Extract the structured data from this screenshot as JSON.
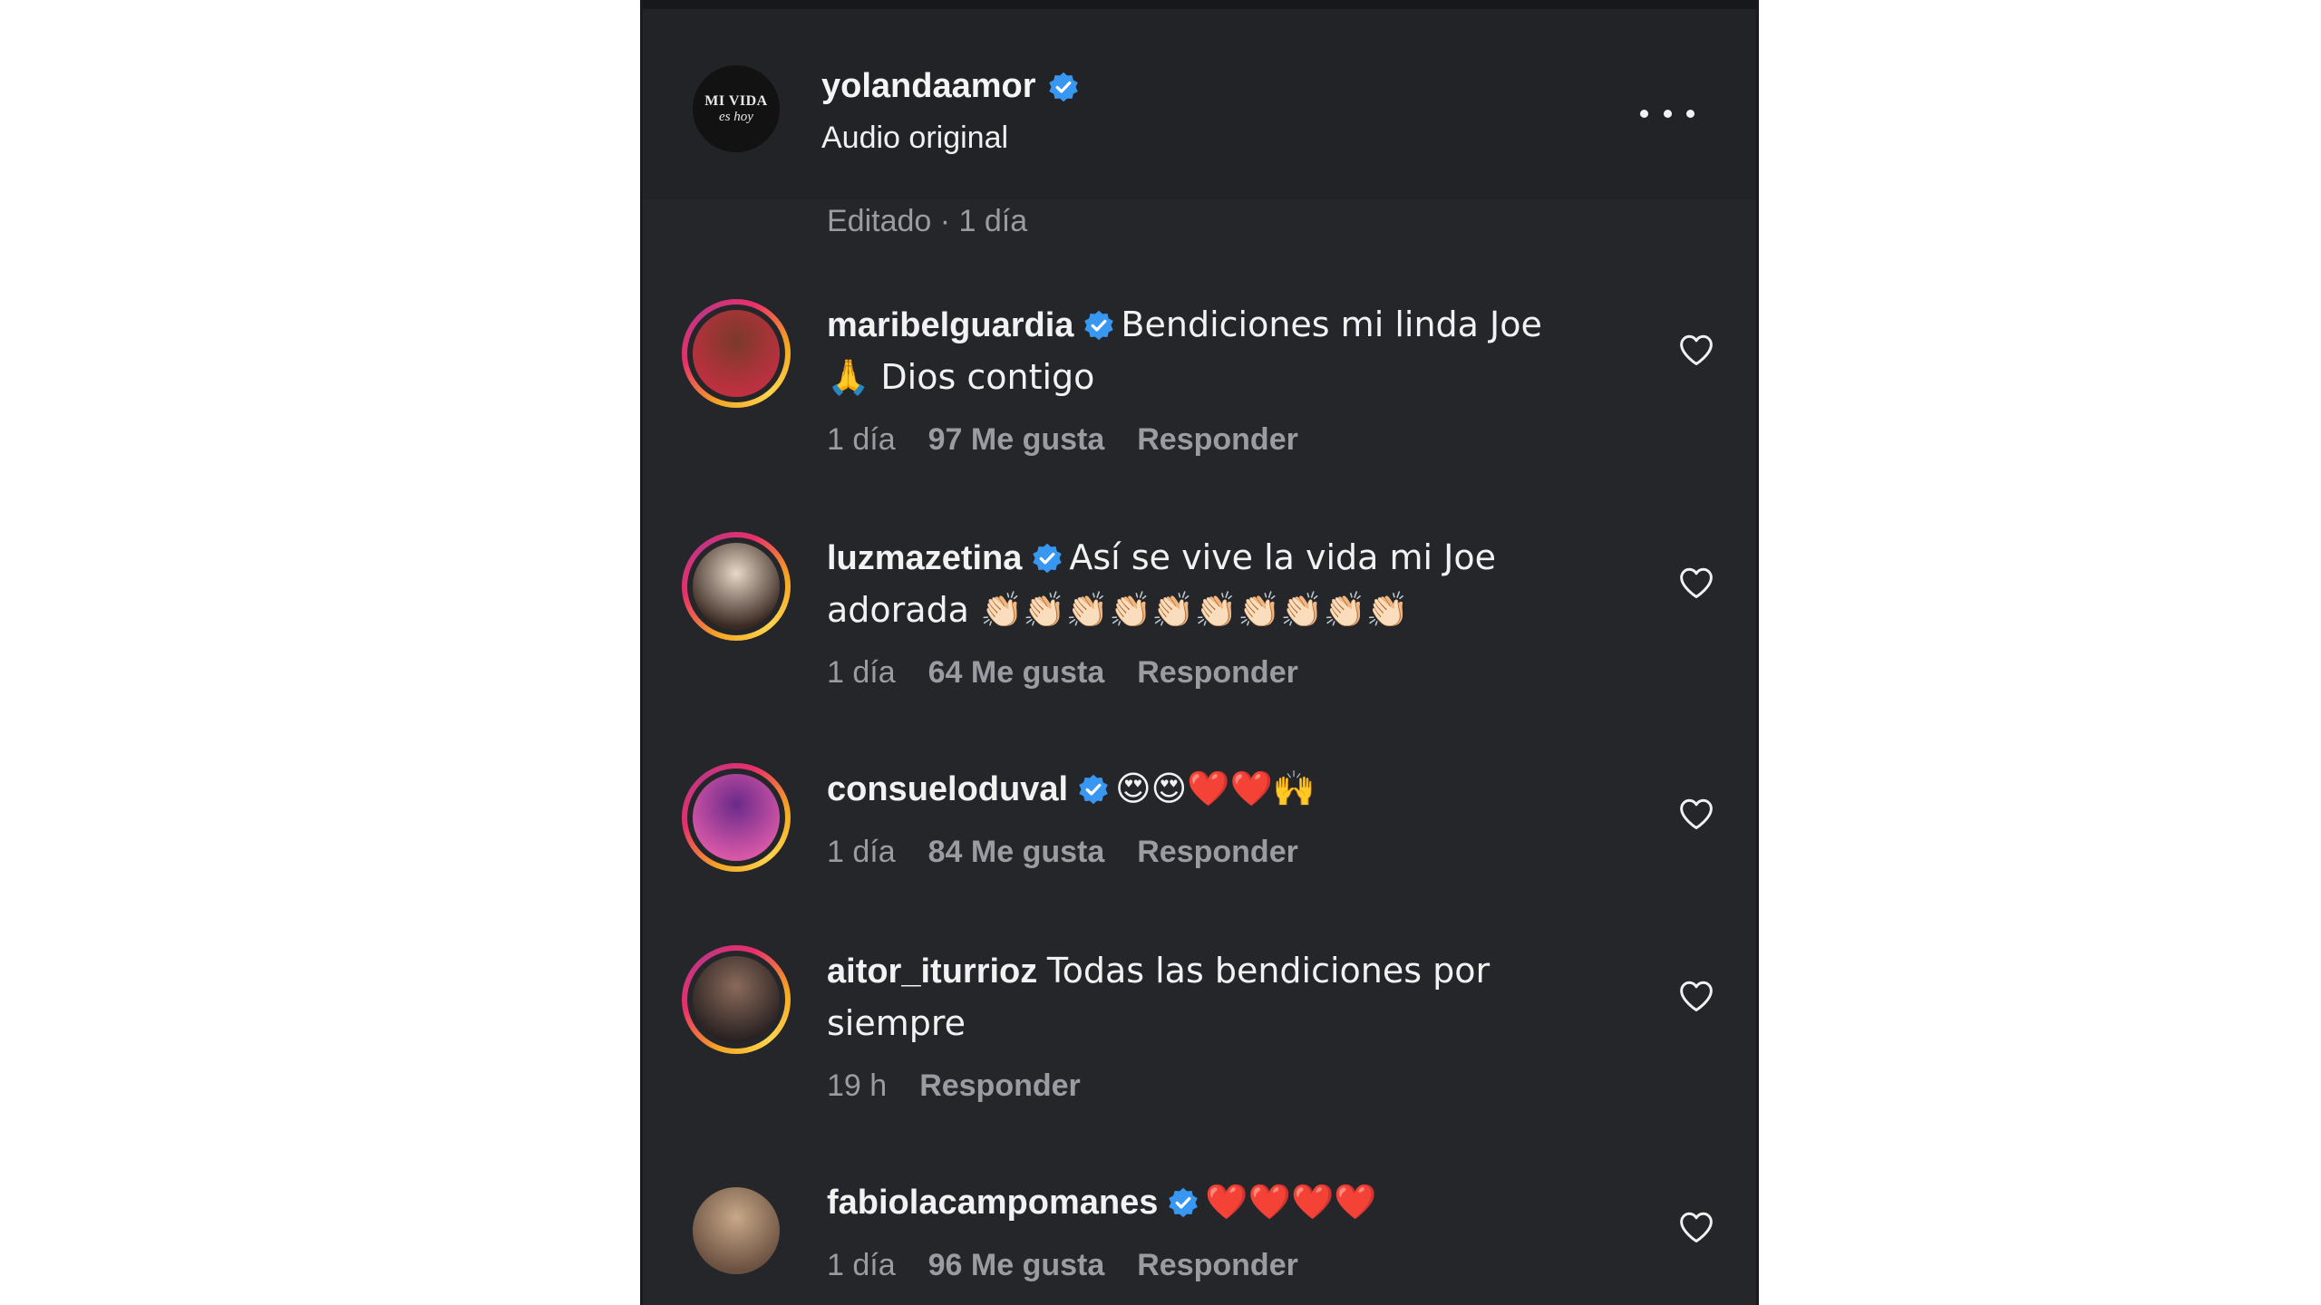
{
  "post": {
    "author": "yolandaamor",
    "audio_label": "Audio original",
    "edited_meta": "Editado · 1 día",
    "avatar_logo_top": "MI VIDA",
    "avatar_logo_bottom": "es hoy"
  },
  "colors": {
    "panel_bg": "#25262a",
    "header_bg": "#222326",
    "text_primary": "#f2f2f2",
    "text_secondary": "#9a9ca2",
    "verified_blue": "#3897f0",
    "heart_red": "#e0245e"
  },
  "comments": [
    {
      "username": "maribelguardia",
      "verified": true,
      "text_line1": "Bendiciones mi linda Joe",
      "text_line2": "🙏 Dios contigo",
      "time": "1 día",
      "likes": "97 Me gusta",
      "reply": "Responder",
      "avatar_colors": [
        "#7a3a2a",
        "#c03040"
      ]
    },
    {
      "username": "luzmazetina",
      "verified": true,
      "text_line1": "Así se vive la vida mi Joe",
      "text_line2": "adorada 👏🏻👏🏻👏🏻👏🏻👏🏻👏🏻👏🏻👏🏻👏🏻👏🏻",
      "time": "1 día",
      "likes": "64 Me gusta",
      "reply": "Responder",
      "avatar_colors": [
        "#e8d8c8",
        "#3a2a22"
      ]
    },
    {
      "username": "consueloduval",
      "verified": true,
      "text_line1": "😍😍❤️❤️🙌",
      "text_line2": "",
      "time": "1 día",
      "likes": "84 Me gusta",
      "reply": "Responder",
      "avatar_colors": [
        "#6a2a8a",
        "#d858a8"
      ]
    },
    {
      "username": "aitor_iturrioz",
      "verified": false,
      "text_line1": "Todas las bendiciones por",
      "text_line2": "siempre",
      "time": "19 h",
      "likes": "",
      "reply": "Responder",
      "avatar_colors": [
        "#8a6a5a",
        "#2a2222"
      ]
    },
    {
      "username": "fabiolacampomanes",
      "verified": true,
      "text_line1": "❤️❤️❤️❤️",
      "text_line2": "",
      "time": "1 día",
      "likes": "96 Me gusta",
      "reply": "Responder",
      "avatar_colors": [
        "#c8a888",
        "#6a5040"
      ]
    }
  ]
}
